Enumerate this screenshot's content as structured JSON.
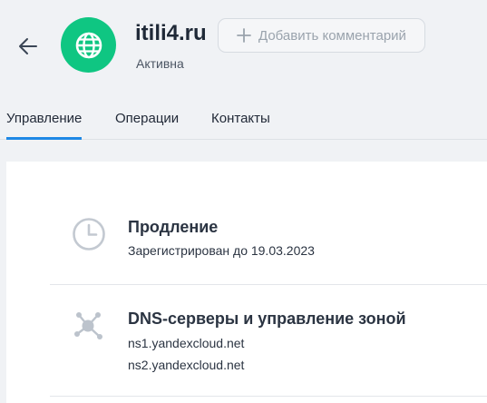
{
  "header": {
    "domain": "itili4.ru",
    "status": "Активна",
    "comment_button": "Добавить комментарий"
  },
  "tabs": [
    {
      "label": "Управление",
      "active": true
    },
    {
      "label": "Операции",
      "active": false
    },
    {
      "label": "Контакты",
      "active": false
    }
  ],
  "sections": {
    "renewal": {
      "title": "Продление",
      "subtitle": "Зарегистрирован до 19.03.2023",
      "icon": "clock-icon"
    },
    "dns": {
      "title": "DNS-серверы и управление зоной",
      "servers": [
        "ns1.yandexcloud.net",
        "ns2.yandexcloud.net"
      ],
      "icon": "network-icon"
    }
  },
  "colors": {
    "accent": "#1e88e5",
    "avatar": "#0fc682",
    "page_bg": "#f0f2f5"
  }
}
